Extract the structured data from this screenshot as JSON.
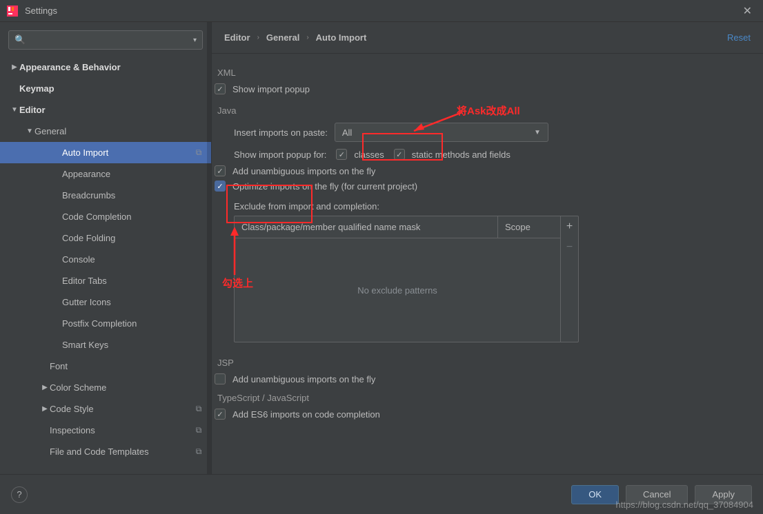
{
  "window": {
    "title": "Settings"
  },
  "search": {
    "placeholder": ""
  },
  "sidebar": {
    "items": [
      {
        "label": "Appearance & Behavior",
        "level": "l0",
        "twist": "▶",
        "bold": true
      },
      {
        "label": "Keymap",
        "level": "l0",
        "twist": "",
        "bold": true
      },
      {
        "label": "Editor",
        "level": "l0",
        "twist": "▼",
        "bold": true
      },
      {
        "label": "General",
        "level": "l1",
        "twist": "▼",
        "bold": false
      },
      {
        "label": "Auto Import",
        "level": "l3",
        "twist": "",
        "bold": false,
        "selected": true,
        "icon": "⧉"
      },
      {
        "label": "Appearance",
        "level": "l3",
        "twist": "",
        "bold": false
      },
      {
        "label": "Breadcrumbs",
        "level": "l3",
        "twist": "",
        "bold": false
      },
      {
        "label": "Code Completion",
        "level": "l3",
        "twist": "",
        "bold": false
      },
      {
        "label": "Code Folding",
        "level": "l3",
        "twist": "",
        "bold": false
      },
      {
        "label": "Console",
        "level": "l3",
        "twist": "",
        "bold": false
      },
      {
        "label": "Editor Tabs",
        "level": "l3",
        "twist": "",
        "bold": false
      },
      {
        "label": "Gutter Icons",
        "level": "l3",
        "twist": "",
        "bold": false
      },
      {
        "label": "Postfix Completion",
        "level": "l3",
        "twist": "",
        "bold": false
      },
      {
        "label": "Smart Keys",
        "level": "l3",
        "twist": "",
        "bold": false
      },
      {
        "label": "Font",
        "level": "l2",
        "twist": "",
        "bold": false
      },
      {
        "label": "Color Scheme",
        "level": "l2",
        "twist": "▶",
        "bold": false
      },
      {
        "label": "Code Style",
        "level": "l2",
        "twist": "▶",
        "bold": false,
        "icon": "⧉"
      },
      {
        "label": "Inspections",
        "level": "l2",
        "twist": "",
        "bold": false,
        "icon": "⧉"
      },
      {
        "label": "File and Code Templates",
        "level": "l2",
        "twist": "",
        "bold": false,
        "icon": "⧉"
      }
    ]
  },
  "breadcrumb": {
    "a": "Editor",
    "b": "General",
    "c": "Auto Import",
    "reset": "Reset"
  },
  "sections": {
    "xml": {
      "title": "XML",
      "showPopup": "Show import popup"
    },
    "java": {
      "title": "Java",
      "insertLabel": "Insert imports on paste:",
      "insertValue": "All",
      "showForLabel": "Show import popup for:",
      "classes": "classes",
      "statics": "static methods and fields",
      "addUnambig": "Add unambiguous imports on the fly",
      "optimize": "Optimize imports on the fly (for current project)",
      "excludeLabel": "Exclude from import and completion:",
      "col1": "Class/package/member qualified name mask",
      "col2": "Scope",
      "emptyText": "No exclude patterns"
    },
    "jsp": {
      "title": "JSP",
      "addUnambig": "Add unambiguous imports on the fly"
    },
    "ts": {
      "title": "TypeScript / JavaScript",
      "addEs6": "Add ES6 imports on code completion"
    }
  },
  "footer": {
    "ok": "OK",
    "cancel": "Cancel",
    "apply": "Apply"
  },
  "annotations": {
    "hint1": "将Ask改成All",
    "hint2": "勾选上"
  },
  "watermark": "https://blog.csdn.net/qq_37084904"
}
